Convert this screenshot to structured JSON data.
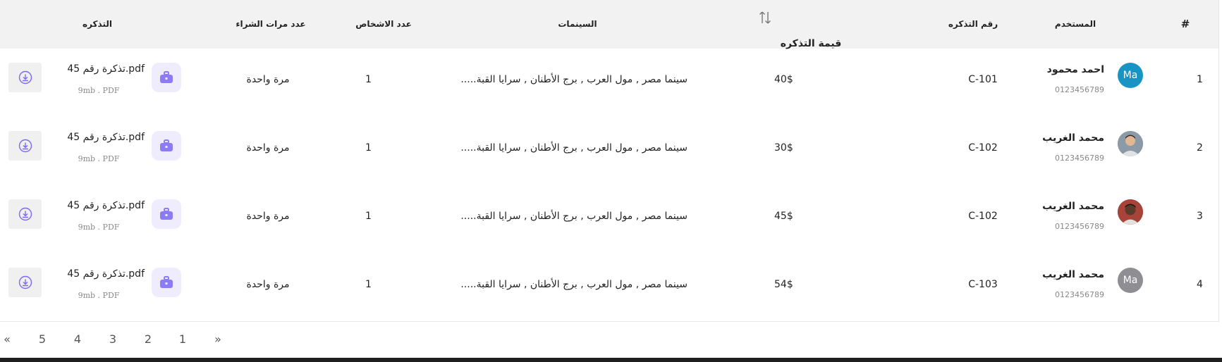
{
  "table": {
    "headers": {
      "index": "#",
      "user": "المستخدم",
      "ticket_number": "رقم التذكره",
      "ticket_value": "قيمة التذكره",
      "cinemas": "السينمات",
      "persons": "عدد الاشخاص",
      "purchases": "عدد مرات الشراء",
      "ticket": "التذكره"
    },
    "rows": [
      {
        "index": "1",
        "avatar_text": "Ma",
        "avatar_color": "#1894c4",
        "name": "احمد محمود",
        "phone": "0123456789",
        "code": "C-101",
        "price": "40$",
        "cinemas": "سينما مصر , مول العرب , برج الأطنان , سرايا القبة.....",
        "persons": "1",
        "purchases": "مرة واحدة",
        "file_name": "تذكرة رقم 45.pdf",
        "file_meta": "9mb . PDF"
      },
      {
        "index": "2",
        "avatar_text": "",
        "avatar_color": "#7d8c99",
        "name": "محمد الغريب",
        "phone": "0123456789",
        "code": "C-102",
        "price": "30$",
        "cinemas": "سينما مصر , مول العرب , برج الأطنان , سرايا القبة.....",
        "persons": "1",
        "purchases": "مرة واحدة",
        "file_name": "تذكرة رقم 45.pdf",
        "file_meta": "9mb . PDF"
      },
      {
        "index": "3",
        "avatar_text": "",
        "avatar_color": "#9c3b33",
        "name": "محمد الغريب",
        "phone": "0123456789",
        "code": "C-102",
        "price": "45$",
        "cinemas": "سينما مصر , مول العرب , برج الأطنان , سرايا القبة.....",
        "persons": "1",
        "purchases": "مرة واحدة",
        "file_name": "تذكرة رقم 45.pdf",
        "file_meta": "9mb . PDF"
      },
      {
        "index": "4",
        "avatar_text": "Ma",
        "avatar_color": "#8e8e93",
        "name": "محمد الغريب",
        "phone": "0123456789",
        "code": "C-103",
        "price": "54$",
        "cinemas": "سينما مصر , مول العرب , برج الأطنان , سرايا القبة.....",
        "persons": "1",
        "purchases": "مرة واحدة",
        "file_name": "تذكرة رقم 45.pdf",
        "file_meta": "9mb . PDF"
      }
    ]
  },
  "pagination": {
    "next": "»",
    "prev": "«",
    "pages": [
      "1",
      "2",
      "3",
      "4",
      "5"
    ]
  },
  "colors": {
    "file_icon": "#8b7cf6",
    "download_icon": "#7a6cf0"
  }
}
